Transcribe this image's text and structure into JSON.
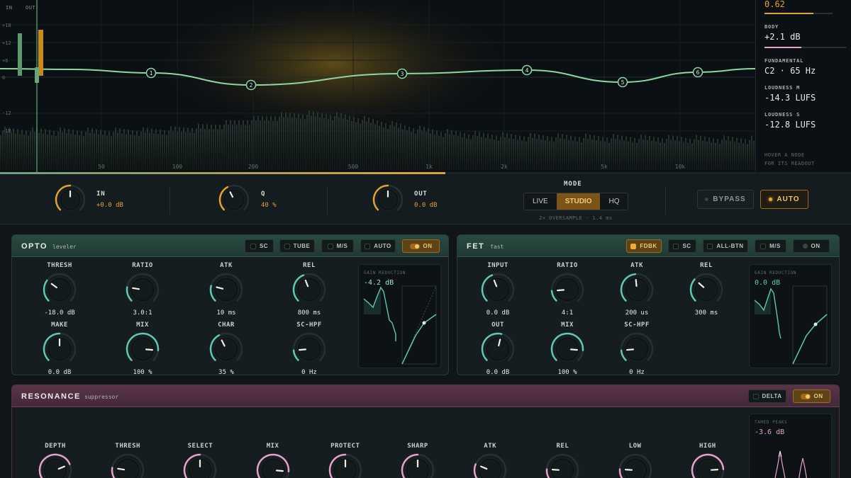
{
  "analyzer": {
    "meter_in_label": "IN",
    "meter_out_label": "OUT",
    "db_scale": [
      "+18",
      "+12",
      "+6",
      "0",
      "-12",
      "-18"
    ],
    "freq_scale": [
      "50",
      "100",
      "200",
      "500",
      "1k",
      "2k",
      "5k",
      "10k"
    ],
    "nodes": [
      "1",
      "2",
      "3",
      "4",
      "5",
      "6"
    ]
  },
  "readout": {
    "top_value": "0.62",
    "body_label": "BODY",
    "body_value": "+2.1 dB",
    "fundamental_label": "FUNDAMENTAL",
    "fundamental_value": "C2 · 65 Hz",
    "loudness_m_label": "LOUDNESS M",
    "loudness_m_value": "-14.3 LUFS",
    "loudness_s_label": "LOUDNESS S",
    "loudness_s_value": "-12.8 LUFS",
    "hint_line1": "HOVER A NODE",
    "hint_line2": "FOR ITS READOUT"
  },
  "strip": {
    "in_label": "IN",
    "in_value": "+0.0 dB",
    "q_label": "Q",
    "q_value": "40 %",
    "out_label": "OUT",
    "out_value": "0.0 dB",
    "mode_title": "MODE",
    "modes": [
      "LIVE",
      "STUDIO",
      "HQ"
    ],
    "mode_sub": "2× OVERSAMPLE · 1.4 ms",
    "bypass_label": "BYPASS",
    "auto_label": "AUTO"
  },
  "opto": {
    "title": "OPTO",
    "subtitle": "leveler",
    "chips": [
      "SC",
      "TUBE",
      "M/S",
      "AUTO"
    ],
    "on_label": "ON",
    "knobs": [
      {
        "label": "THRESH",
        "value": "-18.0 dB"
      },
      {
        "label": "RATIO",
        "value": "3.0:1"
      },
      {
        "label": "ATK",
        "value": "10 ms"
      },
      {
        "label": "REL",
        "value": "800 ms"
      },
      {
        "label": "MAKE",
        "value": "0.0 dB"
      },
      {
        "label": "MIX",
        "value": "100 %"
      },
      {
        "label": "CHAR",
        "value": "35 %"
      },
      {
        "label": "SC-HPF",
        "value": "0 Hz"
      }
    ],
    "gr_label": "GAIN REDUCTION",
    "gr_value": "-4.2 dB"
  },
  "fet": {
    "title": "FET",
    "subtitle": "fast",
    "fdbk_label": "FDBK",
    "chips": [
      "SC",
      "ALL-BTN",
      "M/S"
    ],
    "on_label": "ON",
    "knobs": [
      {
        "label": "INPUT",
        "value": "0.0 dB"
      },
      {
        "label": "RATIO",
        "value": "4:1"
      },
      {
        "label": "ATK",
        "value": "200 us"
      },
      {
        "label": "REL",
        "value": "300 ms"
      },
      {
        "label": "OUT",
        "value": "0.0 dB"
      },
      {
        "label": "MIX",
        "value": "100 %"
      },
      {
        "label": "SC-HPF",
        "value": "0 Hz"
      }
    ],
    "gr_label": "GAIN REDUCTION",
    "gr_value": "0.0 dB"
  },
  "resonance": {
    "title": "RESONANCE",
    "subtitle": "suppressor",
    "delta_label": "DELTA",
    "on_label": "ON",
    "knobs": [
      "DEPTH",
      "THRESH",
      "SELECT",
      "MIX",
      "PROTECT",
      "SHARP",
      "ATK",
      "REL",
      "LOW",
      "HIGH"
    ],
    "tamed_label": "TAMED PEAKS",
    "tamed_value": "-3.6 dB"
  },
  "colors": {
    "accent": "#e2a233",
    "green": "#7fcf98",
    "teal": "#5fc7b2",
    "pink": "#e7a0c8"
  }
}
